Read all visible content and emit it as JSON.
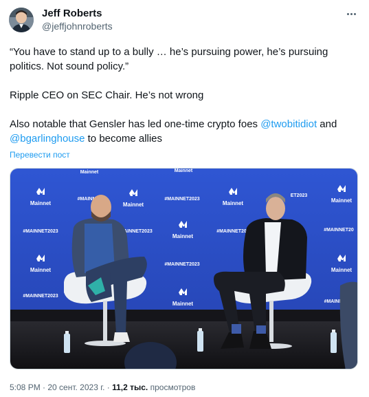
{
  "author": {
    "name": "Jeff Roberts",
    "handle": "@jeffjohnroberts"
  },
  "tweet": {
    "paragraph_1": "“You have to stand up to a bully … he’s pursuing power, he’s pursuing politics. Not sound policy.”",
    "paragraph_2": "Ripple CEO on SEC Chair. He’s not wrong",
    "paragraph_3_part_1": "Also notable that Gensler has led one-time crypto foes ",
    "mention_1": "@twobitidiot",
    "paragraph_3_part_2": " and ",
    "mention_2": "@bgarlinghouse",
    "paragraph_3_part_3": " to become allies"
  },
  "translate_label": "Перевести пост",
  "media": {
    "backdrop_text": {
      "logo_word": "Mainnet",
      "hashtag": "#MAINNET2023",
      "hashtag_short": "#MAINN",
      "hashtag_cut": "MAINNET2023",
      "hashtag_cut_2": "#MAINNET20",
      "hashtag_cut_3": "#MAINNET2",
      "hashtag_cut_4": "ET2023"
    },
    "colors": {
      "backdrop": "#2c4fc4",
      "stage": "#1a1a1f",
      "chair": "#e9ecef"
    }
  },
  "footer": {
    "time": "5:08 PM · 20 сент. 2023 г. · ",
    "views_count": "11,2 тыс.",
    "views_label": " просмотров"
  }
}
